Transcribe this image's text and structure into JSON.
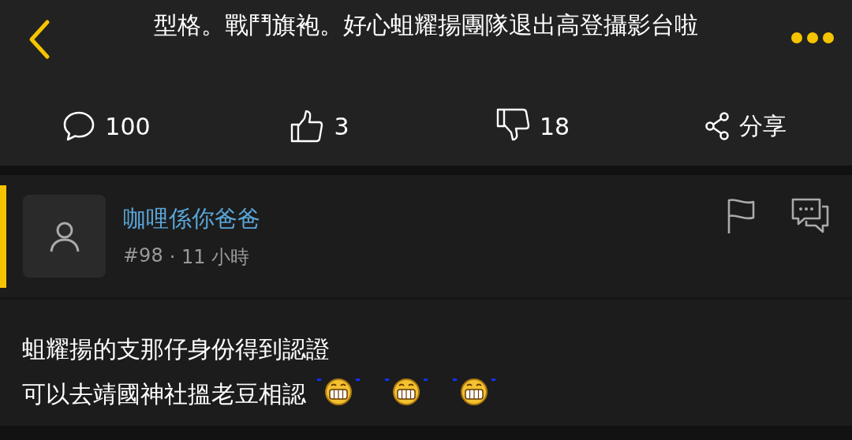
{
  "header": {
    "title": "型格。戰鬥旗袍。好心蛆耀揚團隊退出高登攝影台啦"
  },
  "stats": [
    {
      "kind": "comments",
      "text": "100"
    },
    {
      "kind": "likes",
      "text": "3"
    },
    {
      "kind": "dislikes",
      "text": "18"
    },
    {
      "kind": "share",
      "text": "分享"
    }
  ],
  "post": {
    "highlighted": true,
    "author": "咖哩係你爸爸",
    "number": "#98",
    "time": "· 11 小時",
    "lines": [
      "蛆耀揚的支那仔身份得到認證",
      "可以去靖國神社搵老豆相認"
    ],
    "emojis": [
      {
        "kind": "grin"
      },
      {
        "kind": "grin"
      },
      {
        "kind": "grin"
      }
    ]
  }
}
